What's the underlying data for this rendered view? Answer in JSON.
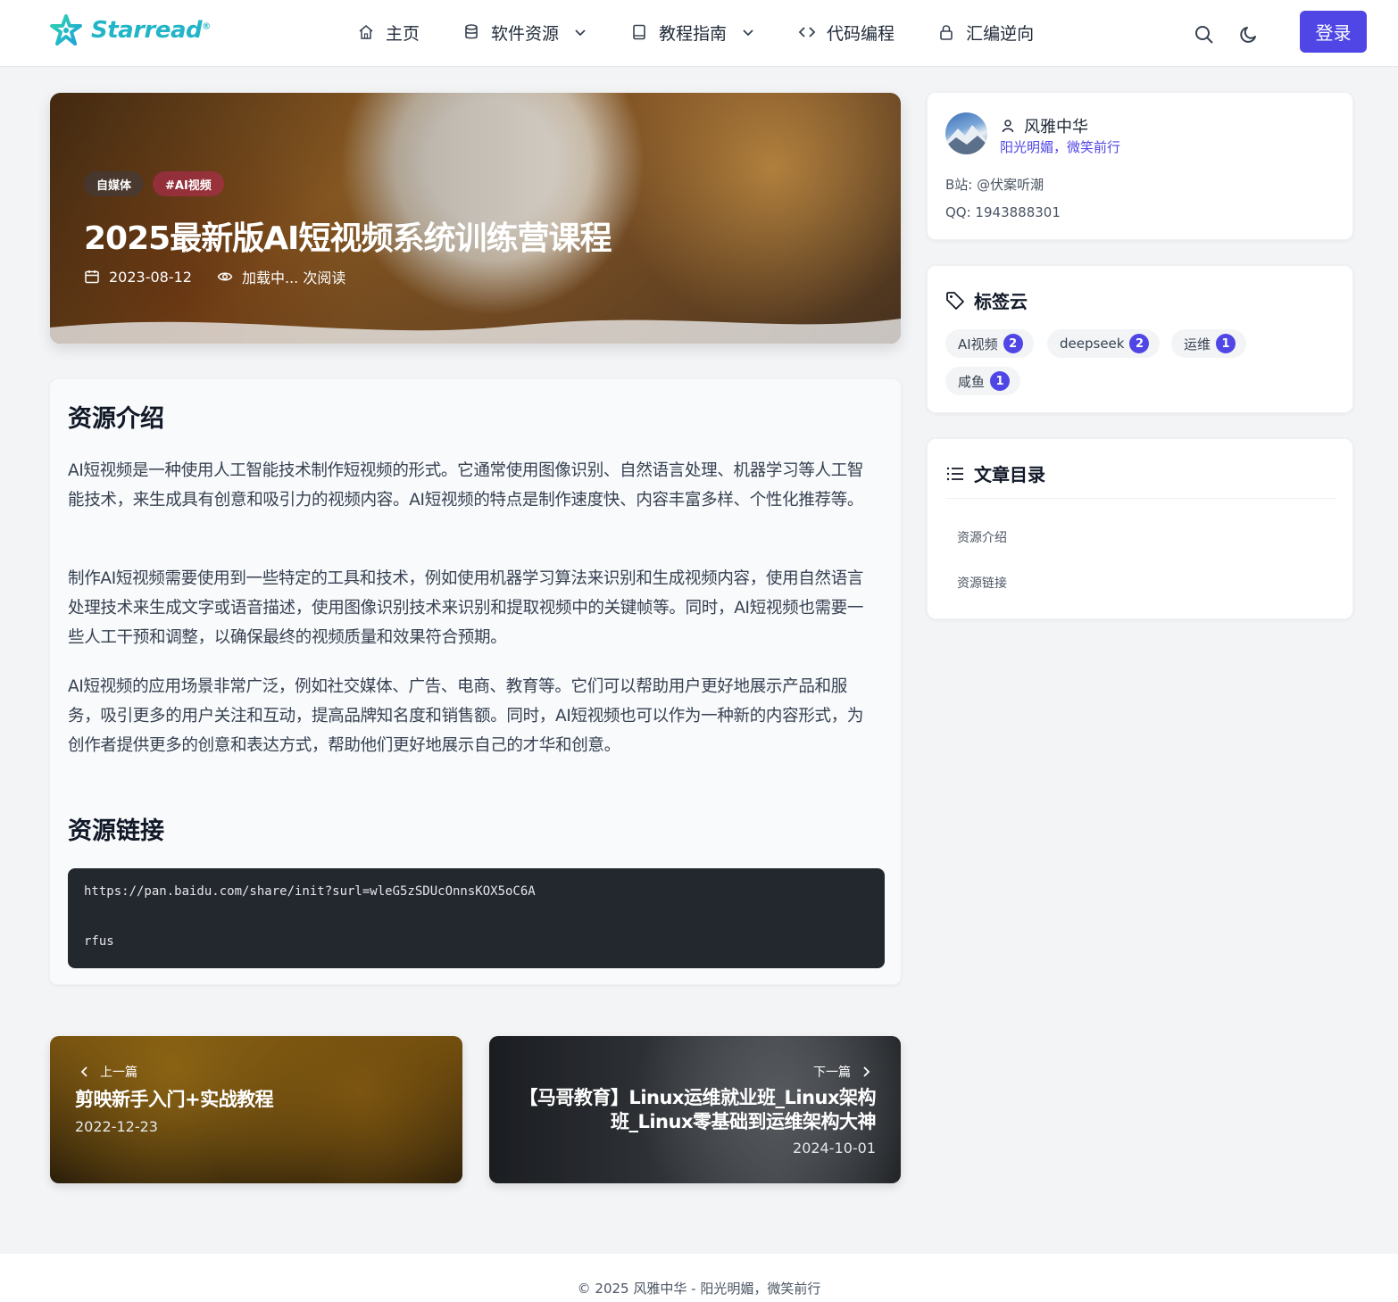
{
  "header": {
    "brand": "Starread",
    "brand_mark": "®",
    "nav": [
      {
        "label": "主页",
        "icon": "home-icon"
      },
      {
        "label": "软件资源",
        "icon": "database-icon",
        "dropdown": true
      },
      {
        "label": "教程指南",
        "icon": "book-icon",
        "dropdown": true
      },
      {
        "label": "代码编程",
        "icon": "code-icon"
      },
      {
        "label": "汇编逆向",
        "icon": "lock-icon"
      }
    ],
    "login_label": "登录",
    "accent": "#4f46e5"
  },
  "hero": {
    "tags": [
      "自媒体",
      "#AI视频"
    ],
    "title": "2025最新版AI短视频系统训练营课程",
    "date": "2023-08-12",
    "views": "加载中... 次阅读"
  },
  "article": {
    "intro_heading": "资源介绍",
    "paragraphs": [
      "AI短视频是一种使用人工智能技术制作短视频的形式。它通常使用图像识别、自然语言处理、机器学习等人工智能技术，来生成具有创意和吸引力的视频内容。AI短视频的特点是制作速度快、内容丰富多样、个性化推荐等。",
      "制作AI短视频需要使用到一些特定的工具和技术，例如使用机器学习算法来识别和生成视频内容，使用自然语言处理技术来生成文字或语音描述，使用图像识别技术来识别和提取视频中的关键帧等。同时，AI短视频也需要一些人工干预和调整，以确保最终的视频质量和效果符合预期。",
      "AI短视频的应用场景非常广泛，例如社交媒体、广告、电商、教育等。它们可以帮助用户更好地展示产品和服务，吸引更多的用户关注和互动，提高品牌知名度和销售额。同时，AI短视频也可以作为一种新的内容形式，为创作者提供更多的创意和表达方式，帮助他们更好地展示自己的才华和创意。"
    ],
    "link_heading": "资源链接",
    "link_url": "https://pan.baidu.com/share/init?surl=wleG5zSDUcOnnsKOX5oC6A",
    "link_code": "rfus"
  },
  "prev": {
    "label": "上一篇",
    "title": "剪映新手入门+实战教程",
    "date": "2022-12-23"
  },
  "next": {
    "label": "下一篇",
    "title_line1": "【马哥教育】Linux运维就业班_Linux架构",
    "title_line2": "班_Linux零基础到运维架构大神",
    "date": "2024-10-01"
  },
  "profile": {
    "name": "风雅中华",
    "motto": "阳光明媚，微笑前行",
    "bili": "B站: @伏案听潮",
    "qq": "QQ: 1943888301"
  },
  "tag_cloud": {
    "heading": "标签云",
    "items": [
      {
        "label": "AI视频",
        "count": "2"
      },
      {
        "label": "deepseek",
        "count": "2"
      },
      {
        "label": "运维",
        "count": "1"
      },
      {
        "label": "咸鱼",
        "count": "1"
      }
    ]
  },
  "toc": {
    "heading": "文章目录",
    "items": [
      "资源介绍",
      "资源链接"
    ]
  },
  "footer": {
    "text": "© 2025 风雅中华 - 阳光明媚，微笑前行"
  }
}
